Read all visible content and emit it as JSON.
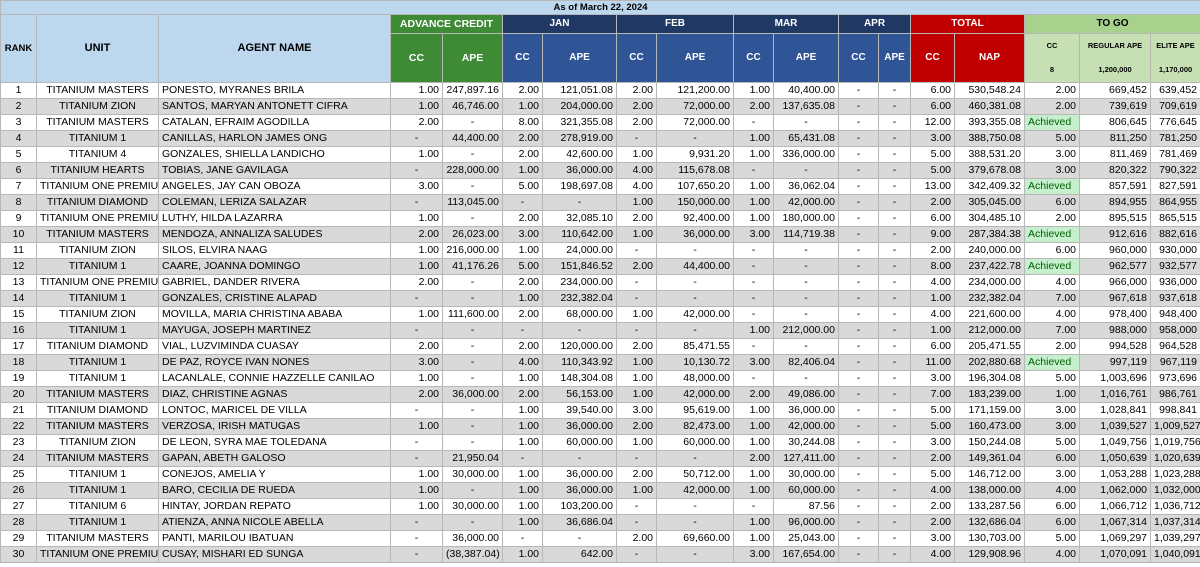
{
  "title": "As of March 22, 2024",
  "headers": {
    "rank": "RANK",
    "unit": "UNIT",
    "agent": "AGENT NAME",
    "advance_credit": "ADVANCE CREDIT",
    "jan": "JAN",
    "feb": "FEB",
    "mar": "MAR",
    "apr": "APR",
    "total": "TOTAL",
    "to_go": "TO GO",
    "cc": "CC",
    "ape": "APE",
    "nap": "NAP",
    "cc_target": "8",
    "regular_ape": "REGULAR APE",
    "regular_ape_target": "1,200,000",
    "elite_ape": "ELITE APE",
    "elite_ape_target": "1,170,000"
  },
  "rows": [
    [
      "1",
      "TITANIUM MASTERS",
      "PONESTO, MYRANES BRILA",
      "1.00",
      "247,897.16",
      "2.00",
      "121,051.08",
      "2.00",
      "121,200.00",
      "1.00",
      "40,400.00",
      "-",
      "-",
      "6.00",
      "530,548.24",
      "2.00",
      "669,452",
      "639,452"
    ],
    [
      "2",
      "TITANIUM ZION",
      "SANTOS, MARYAN ANTONETT CIFRA",
      "1.00",
      "46,746.00",
      "1.00",
      "204,000.00",
      "2.00",
      "72,000.00",
      "2.00",
      "137,635.08",
      "-",
      "-",
      "6.00",
      "460,381.08",
      "2.00",
      "739,619",
      "709,619"
    ],
    [
      "3",
      "TITANIUM MASTERS",
      "CATALAN, EFRAIM AGODILLA",
      "2.00",
      "-",
      "8.00",
      "321,355.08",
      "2.00",
      "72,000.00",
      "-",
      "-",
      "-",
      "-",
      "12.00",
      "393,355.08",
      "Achieved",
      "806,645",
      "776,645"
    ],
    [
      "4",
      "TITANIUM 1",
      "CANILLAS, HARLON JAMES ONG",
      "-",
      "44,400.00",
      "2.00",
      "278,919.00",
      "-",
      "-",
      "1.00",
      "65,431.08",
      "-",
      "-",
      "3.00",
      "388,750.08",
      "5.00",
      "811,250",
      "781,250"
    ],
    [
      "5",
      "TITANIUM 4",
      "GONZALES, SHIELLA LANDICHO",
      "1.00",
      "-",
      "2.00",
      "42,600.00",
      "1.00",
      "9,931.20",
      "1.00",
      "336,000.00",
      "-",
      "-",
      "5.00",
      "388,531.20",
      "3.00",
      "811,469",
      "781,469"
    ],
    [
      "6",
      "TITANIUM HEARTS",
      "TOBIAS, JANE GAVILAGA",
      "-",
      "228,000.00",
      "1.00",
      "36,000.00",
      "4.00",
      "115,678.08",
      "-",
      "-",
      "-",
      "-",
      "5.00",
      "379,678.08",
      "3.00",
      "820,322",
      "790,322"
    ],
    [
      "7",
      "TITANIUM ONE PREMIUM",
      "ANGELES, JAY CAN OBOZA",
      "3.00",
      "-",
      "5.00",
      "198,697.08",
      "4.00",
      "107,650.20",
      "1.00",
      "36,062.04",
      "-",
      "-",
      "13.00",
      "342,409.32",
      "Achieved",
      "857,591",
      "827,591"
    ],
    [
      "8",
      "TITANIUM DIAMOND",
      "COLEMAN, LERIZA SALAZAR",
      "-",
      "113,045.00",
      "-",
      "-",
      "1.00",
      "150,000.00",
      "1.00",
      "42,000.00",
      "-",
      "-",
      "2.00",
      "305,045.00",
      "6.00",
      "894,955",
      "864,955"
    ],
    [
      "9",
      "TITANIUM ONE PREMIUM",
      "LUTHY, HILDA LAZARRA",
      "1.00",
      "-",
      "2.00",
      "32,085.10",
      "2.00",
      "92,400.00",
      "1.00",
      "180,000.00",
      "-",
      "-",
      "6.00",
      "304,485.10",
      "2.00",
      "895,515",
      "865,515"
    ],
    [
      "10",
      "TITANIUM MASTERS",
      "MENDOZA, ANNALIZA SALUDES",
      "2.00",
      "26,023.00",
      "3.00",
      "110,642.00",
      "1.00",
      "36,000.00",
      "3.00",
      "114,719.38",
      "-",
      "-",
      "9.00",
      "287,384.38",
      "Achieved",
      "912,616",
      "882,616"
    ],
    [
      "11",
      "TITANIUM ZION",
      "SILOS, ELVIRA NAAG",
      "1.00",
      "216,000.00",
      "1.00",
      "24,000.00",
      "-",
      "-",
      "-",
      "-",
      "-",
      "-",
      "2.00",
      "240,000.00",
      "6.00",
      "960,000",
      "930,000"
    ],
    [
      "12",
      "TITANIUM 1",
      "CAARE, JOANNA DOMINGO",
      "1.00",
      "41,176.26",
      "5.00",
      "151,846.52",
      "2.00",
      "44,400.00",
      "-",
      "-",
      "-",
      "-",
      "8.00",
      "237,422.78",
      "Achieved",
      "962,577",
      "932,577"
    ],
    [
      "13",
      "TITANIUM ONE PREMIUM",
      "GABRIEL, DANDER RIVERA",
      "2.00",
      "-",
      "2.00",
      "234,000.00",
      "-",
      "-",
      "-",
      "-",
      "-",
      "-",
      "4.00",
      "234,000.00",
      "4.00",
      "966,000",
      "936,000"
    ],
    [
      "14",
      "TITANIUM 1",
      "GONZALES, CRISTINE ALAPAD",
      "-",
      "-",
      "1.00",
      "232,382.04",
      "-",
      "-",
      "-",
      "-",
      "-",
      "-",
      "1.00",
      "232,382.04",
      "7.00",
      "967,618",
      "937,618"
    ],
    [
      "15",
      "TITANIUM ZION",
      "MOVILLA, MARIA CHRISTINA ABABA",
      "1.00",
      "111,600.00",
      "2.00",
      "68,000.00",
      "1.00",
      "42,000.00",
      "-",
      "-",
      "-",
      "-",
      "4.00",
      "221,600.00",
      "4.00",
      "978,400",
      "948,400"
    ],
    [
      "16",
      "TITANIUM 1",
      "MAYUGA, JOSEPH MARTINEZ",
      "-",
      "-",
      "-",
      "-",
      "-",
      "-",
      "1.00",
      "212,000.00",
      "-",
      "-",
      "1.00",
      "212,000.00",
      "7.00",
      "988,000",
      "958,000"
    ],
    [
      "17",
      "TITANIUM DIAMOND",
      "VIAL, LUZVIMINDA CUASAY",
      "2.00",
      "-",
      "2.00",
      "120,000.00",
      "2.00",
      "85,471.55",
      "-",
      "-",
      "-",
      "-",
      "6.00",
      "205,471.55",
      "2.00",
      "994,528",
      "964,528"
    ],
    [
      "18",
      "TITANIUM 1",
      "DE PAZ, ROYCE IVAN NONES",
      "3.00",
      "-",
      "4.00",
      "110,343.92",
      "1.00",
      "10,130.72",
      "3.00",
      "82,406.04",
      "-",
      "-",
      "11.00",
      "202,880.68",
      "Achieved",
      "997,119",
      "967,119"
    ],
    [
      "19",
      "TITANIUM 1",
      "LACANLALE, CONNIE HAZZELLE CANILAO",
      "1.00",
      "-",
      "1.00",
      "148,304.08",
      "1.00",
      "48,000.00",
      "-",
      "-",
      "-",
      "-",
      "3.00",
      "196,304.08",
      "5.00",
      "1,003,696",
      "973,696"
    ],
    [
      "20",
      "TITANIUM MASTERS",
      "DIAZ, CHRISTINE AGNAS",
      "2.00",
      "36,000.00",
      "2.00",
      "56,153.00",
      "1.00",
      "42,000.00",
      "2.00",
      "49,086.00",
      "-",
      "-",
      "7.00",
      "183,239.00",
      "1.00",
      "1,016,761",
      "986,761"
    ],
    [
      "21",
      "TITANIUM DIAMOND",
      "LONTOC, MARICEL DE VILLA",
      "-",
      "-",
      "1.00",
      "39,540.00",
      "3.00",
      "95,619.00",
      "1.00",
      "36,000.00",
      "-",
      "-",
      "5.00",
      "171,159.00",
      "3.00",
      "1,028,841",
      "998,841"
    ],
    [
      "22",
      "TITANIUM MASTERS",
      "VERZOSA, IRISH MATUGAS",
      "1.00",
      "-",
      "1.00",
      "36,000.00",
      "2.00",
      "82,473.00",
      "1.00",
      "42,000.00",
      "-",
      "-",
      "5.00",
      "160,473.00",
      "3.00",
      "1,039,527",
      "1,009,527"
    ],
    [
      "23",
      "TITANIUM ZION",
      "DE LEON, SYRA MAE TOLEDANA",
      "-",
      "-",
      "1.00",
      "60,000.00",
      "1.00",
      "60,000.00",
      "1.00",
      "30,244.08",
      "-",
      "-",
      "3.00",
      "150,244.08",
      "5.00",
      "1,049,756",
      "1,019,756"
    ],
    [
      "24",
      "TITANIUM MASTERS",
      "GAPAN, ABETH GALOSO",
      "-",
      "21,950.04",
      "-",
      "-",
      "-",
      "-",
      "2.00",
      "127,411.00",
      "-",
      "-",
      "2.00",
      "149,361.04",
      "6.00",
      "1,050,639",
      "1,020,639"
    ],
    [
      "25",
      "TITANIUM 1",
      "CONEJOS, AMELIA Y",
      "1.00",
      "30,000.00",
      "1.00",
      "36,000.00",
      "2.00",
      "50,712.00",
      "1.00",
      "30,000.00",
      "-",
      "-",
      "5.00",
      "146,712.00",
      "3.00",
      "1,053,288",
      "1,023,288"
    ],
    [
      "26",
      "TITANIUM 1",
      "BARO, CECILIA DE RUEDA",
      "1.00",
      "-",
      "1.00",
      "36,000.00",
      "1.00",
      "42,000.00",
      "1.00",
      "60,000.00",
      "-",
      "-",
      "4.00",
      "138,000.00",
      "4.00",
      "1,062,000",
      "1,032,000"
    ],
    [
      "27",
      "TITANIUM 6",
      "HINTAY, JORDAN REPATO",
      "1.00",
      "30,000.00",
      "1.00",
      "103,200.00",
      "-",
      "-",
      "-",
      "87.56",
      "-",
      "-",
      "2.00",
      "133,287.56",
      "6.00",
      "1,066,712",
      "1,036,712"
    ],
    [
      "28",
      "TITANIUM 1",
      "ATIENZA, ANNA NICOLE ABELLA",
      "-",
      "-",
      "1.00",
      "36,686.04",
      "-",
      "-",
      "1.00",
      "96,000.00",
      "-",
      "-",
      "2.00",
      "132,686.04",
      "6.00",
      "1,067,314",
      "1,037,314"
    ],
    [
      "29",
      "TITANIUM MASTERS",
      "PANTI, MARILOU IBATUAN",
      "-",
      "36,000.00",
      "-",
      "-",
      "2.00",
      "69,660.00",
      "1.00",
      "25,043.00",
      "-",
      "-",
      "3.00",
      "130,703.00",
      "5.00",
      "1,069,297",
      "1,039,297"
    ],
    [
      "30",
      "TITANIUM ONE PREMIUM",
      "CUSAY, MISHARI ED SUNGA",
      "-",
      "(38,387.04)",
      "1.00",
      "642.00",
      "-",
      "-",
      "3.00",
      "167,654.00",
      "-",
      "-",
      "4.00",
      "129,908.96",
      "4.00",
      "1,070,091",
      "1,040,091"
    ]
  ]
}
